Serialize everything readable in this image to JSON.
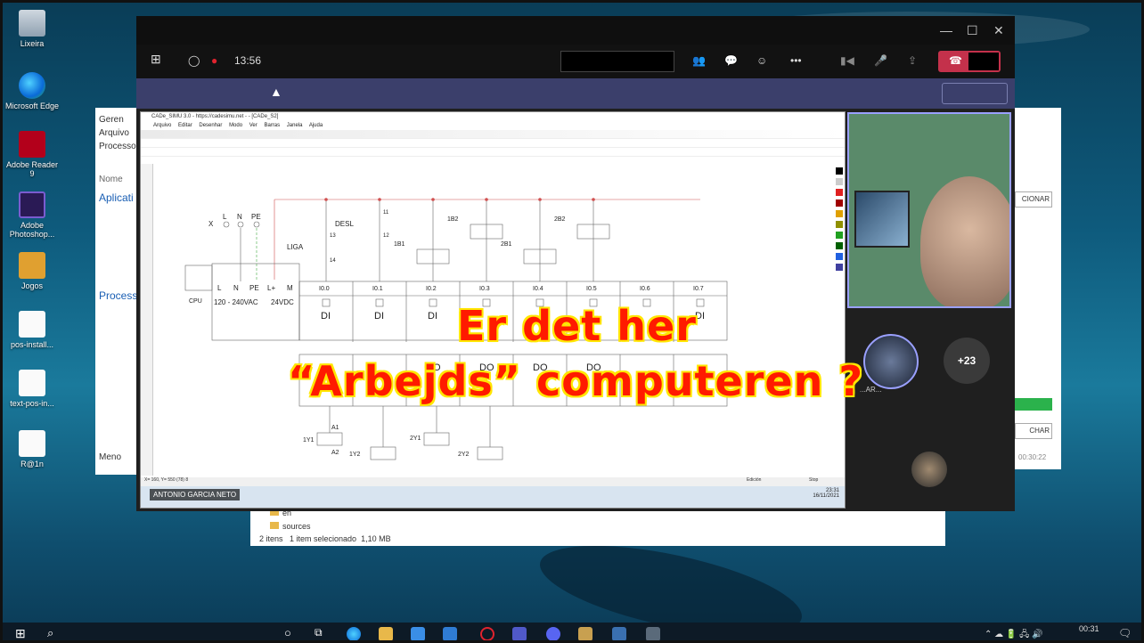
{
  "desktop": {
    "icons": [
      {
        "label": "Lixeira"
      },
      {
        "label": "Microsoft Edge"
      },
      {
        "label": "Adobe Reader 9"
      },
      {
        "label": "Adobe Photoshop..."
      },
      {
        "label": "Jogos"
      },
      {
        "label": "pos-install..."
      },
      {
        "label": "text-pos-in..."
      },
      {
        "label": "R@1n"
      }
    ]
  },
  "teams": {
    "timer": "13:56",
    "warning_icon": "warning-icon",
    "plus_count": "+23",
    "participant_label": "...AR..."
  },
  "explorer_left": {
    "items": [
      "Geren",
      "Arquivo",
      "Processos",
      "Nome",
      "Aplicati",
      "Process",
      "Meno"
    ]
  },
  "explorer_bottom": {
    "folders": [
      "en",
      "sources"
    ],
    "status": "2 itens   1 item selecionado  1,10 MB"
  },
  "right_panel": {
    "btn1": "CIONAR",
    "btn2": "CHAR",
    "time": "00:30:22"
  },
  "cade": {
    "title": "CADe_SIMU 3.0 - https://cadesimu.net - - [CADe_S2]",
    "menu": [
      "Arquivo",
      "Editar",
      "Desenhar",
      "Modo",
      "Ver",
      "Barras",
      "Janela",
      "Ajuda"
    ],
    "status_left": "X= 160, Y= 550 (78) 8",
    "status_mid": "Edición",
    "status_right": "Stop",
    "clock_time": "23:31",
    "clock_date": "16/11/2021",
    "presenter": "ANTONIO GARCIA NETO"
  },
  "diagram": {
    "power_labels": [
      "X",
      "L",
      "N",
      "PE"
    ],
    "switches": [
      "DESL",
      "LIGA",
      "13",
      "14",
      "11",
      "12",
      "1B1",
      "1B2",
      "2B1",
      "2B2"
    ],
    "cpu_label": "CPU",
    "cpu_cols": [
      "L",
      "N",
      "PE",
      "L+",
      "M"
    ],
    "cpu_supply": "120 - 240VAC",
    "cpu_dc": "24VDC",
    "inputs": [
      "I0.0",
      "I0.1",
      "I0.2",
      "I0.3",
      "I0.4",
      "I0.5",
      "I0.6",
      "I0.7"
    ],
    "di": "DI",
    "do": "DO",
    "outputs_prefix": "Q0.",
    "coils": [
      "1Y1",
      "1Y2",
      "2Y1",
      "2Y2"
    ],
    "coil_terms": [
      "A1",
      "A2"
    ]
  },
  "overlay": {
    "line1": "Er det her",
    "line2": "“Arbejds” computeren ?"
  },
  "taskbar": {
    "time": "00:31",
    "search_icon": "search-icon"
  }
}
